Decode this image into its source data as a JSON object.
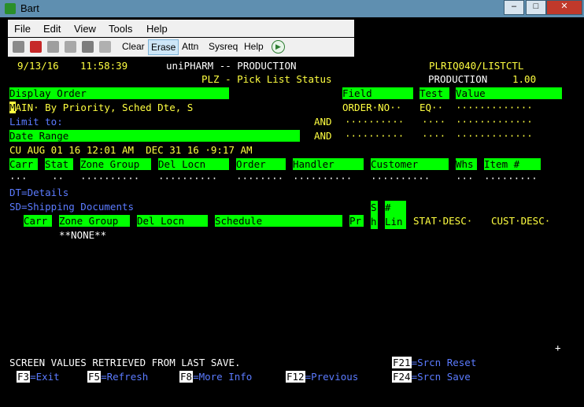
{
  "window": {
    "title": "Bart"
  },
  "menu": [
    "File",
    "Edit",
    "View",
    "Tools",
    "Help"
  ],
  "toolbar": {
    "clear": "Clear",
    "erase": "Erase",
    "attn": "Attn",
    "sysreq": "Sysreq",
    "help": "Help"
  },
  "header": {
    "date": "9/13/16",
    "time": "11:58:39",
    "system": "uniPHARM -- PRODUCTION",
    "program": "PLRIQ040/LISTCTL",
    "screen_title": "PLZ - Pick List Status",
    "env": "PRODUCTION",
    "version": "1.00"
  },
  "labels": {
    "display_order": "Display Order",
    "field": "Field",
    "test": "Test",
    "value": "Value",
    "limit_to": "Limit to:",
    "date_range": "Date Range",
    "and1": "AND",
    "and2": "AND",
    "dt": "DT=Details",
    "sd": "SD=Shipping Documents",
    "none": "**NONE**",
    "status": "SCREEN VALUES RETRIEVED FROM LAST SAVE."
  },
  "inputs": {
    "order_first": "M",
    "order_rest": "AIN· By Priority, Sched Dte, S",
    "field1": "ORDER·NO··",
    "test1": "EQ··",
    "value1": "·············",
    "field2": "··········",
    "test2": "····",
    "value2": "·············",
    "field3": "··········",
    "test3": "····",
    "value3": "·············",
    "date_range_value": "CU AUG 01 16 12:01 AM  DEC 31 16 ·9:17 AM"
  },
  "filter_columns": [
    "Carr",
    "Stat",
    "Zone Group",
    "Del Locn",
    "Order",
    "Handler",
    "Customer",
    "Whs",
    "Item #"
  ],
  "filter_values": [
    "···",
    "··",
    "··········",
    "··········",
    "········",
    "··········",
    "··········",
    "···",
    "·········"
  ],
  "list_columns": {
    "carr": "Carr",
    "zone_group": "Zone Group",
    "del_locn": "Del Locn",
    "schedule": "Schedule",
    "pr": "Pr",
    "sh": "S\nh",
    "lin": "#\nLin",
    "stat_desc": "STAT·DESC·",
    "cust_desc": "CUST·DESC·"
  },
  "function_keys": [
    {
      "key": "F21",
      "label": "=Srcn Reset"
    },
    {
      "key": "F3",
      "label": "=Exit"
    },
    {
      "key": "F5",
      "label": "=Refresh"
    },
    {
      "key": "F8",
      "label": "=More Info"
    },
    {
      "key": "F12",
      "label": "=Previous"
    },
    {
      "key": "F24",
      "label": "=Srcn Save"
    }
  ],
  "colors": {
    "field_green": "#00ff00",
    "header_yellow": "#ffff40",
    "prompt_blue": "#5b7bff"
  }
}
